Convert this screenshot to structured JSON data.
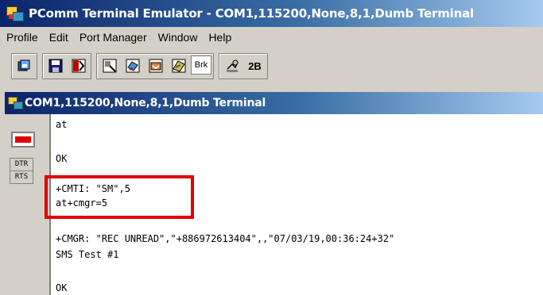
{
  "window": {
    "title": "PComm Terminal Emulator - COM1,115200,None,8,1,Dumb Terminal"
  },
  "menu": [
    "Profile",
    "Edit",
    "Port Manager",
    "Window",
    "Help"
  ],
  "toolbar": {
    "brk_label": "Brk",
    "twob_label": "2B"
  },
  "terminal_window": {
    "title": "COM1,115200,None,8,1,Dumb Terminal",
    "signals": {
      "dtr": "DTR",
      "rts": "RTS"
    },
    "lines": [
      "at",
      "OK",
      "+CMTI: \"SM\",5",
      "at+cmgr=5",
      "+CMGR: \"REC UNREAD\",\"+886972613404\",,\"07/03/19,00:36:24+32\"",
      "SMS Test #1",
      "OK"
    ]
  },
  "colors": {
    "highlight": "#e00000",
    "titlebar": "#0a246a"
  }
}
